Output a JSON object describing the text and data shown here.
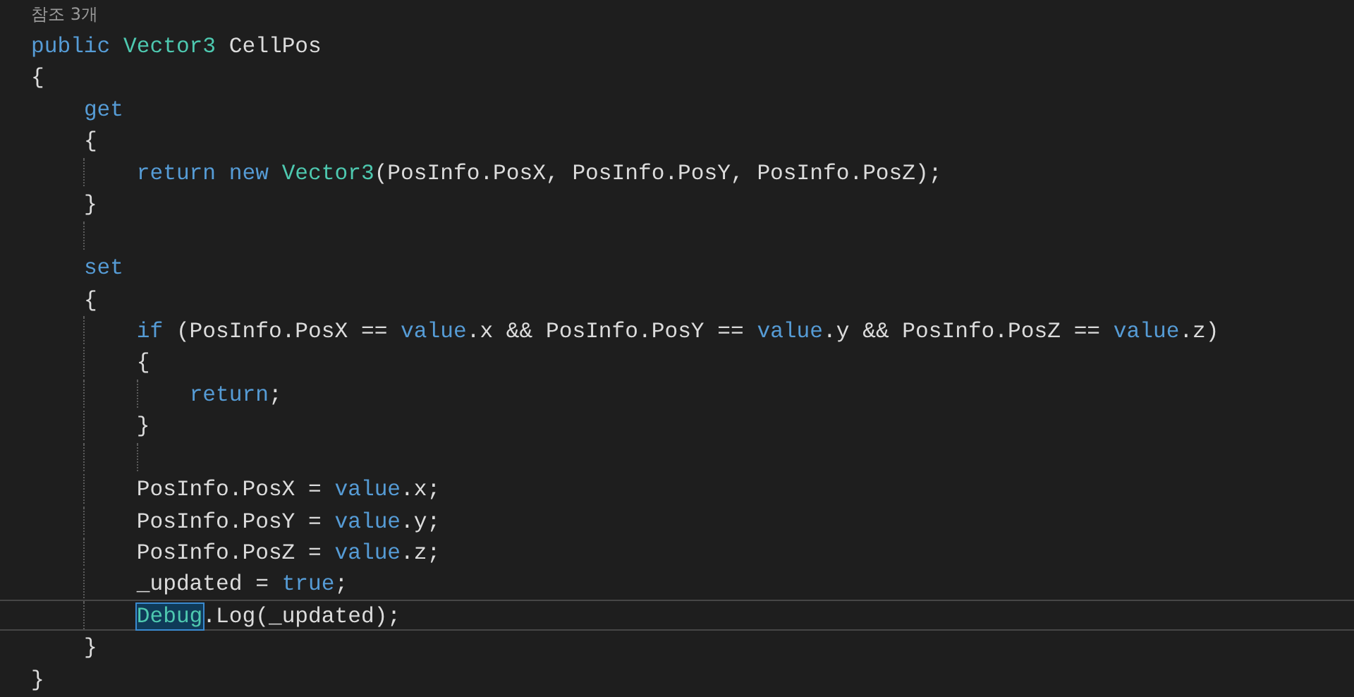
{
  "code_lens": "참조 3개",
  "lines": [
    {
      "current": false,
      "tokens": [
        {
          "text": "public ",
          "kind": "keyword"
        },
        {
          "text": "Vector3",
          "kind": "type"
        },
        {
          "text": " CellPos",
          "kind": "plain"
        }
      ]
    },
    {
      "current": false,
      "tokens": [
        {
          "text": "{",
          "kind": "plain"
        }
      ]
    },
    {
      "current": false,
      "tokens": [
        {
          "text": "get",
          "kind": "keyword"
        }
      ]
    },
    {
      "current": false,
      "tokens": [
        {
          "text": "{",
          "kind": "plain"
        }
      ]
    },
    {
      "current": false,
      "tokens": [
        {
          "text": "return new ",
          "kind": "keyword"
        },
        {
          "text": "Vector3",
          "kind": "type"
        },
        {
          "text": "(PosInfo.PosX, PosInfo.PosY, PosInfo.PosZ);",
          "kind": "plain"
        }
      ]
    },
    {
      "current": false,
      "tokens": [
        {
          "text": "}",
          "kind": "plain"
        }
      ]
    },
    {
      "current": false
    },
    {
      "current": false,
      "tokens": [
        {
          "text": "set",
          "kind": "keyword"
        }
      ]
    },
    {
      "current": false,
      "tokens": [
        {
          "text": "{",
          "kind": "plain"
        }
      ]
    },
    {
      "current": false,
      "tokens": [
        {
          "text": "if",
          "kind": "keyword"
        },
        {
          "text": " (PosInfo.PosX == ",
          "kind": "plain"
        },
        {
          "text": "value",
          "kind": "keyword"
        },
        {
          "text": ".x && PosInfo.PosY == ",
          "kind": "plain"
        },
        {
          "text": "value",
          "kind": "keyword"
        },
        {
          "text": ".y && PosInfo.PosZ == ",
          "kind": "plain"
        },
        {
          "text": "value",
          "kind": "keyword"
        },
        {
          "text": ".z)",
          "kind": "plain"
        }
      ]
    },
    {
      "current": false,
      "tokens": [
        {
          "text": "{",
          "kind": "plain"
        }
      ]
    },
    {
      "current": false,
      "tokens": [
        {
          "text": "return",
          "kind": "keyword"
        },
        {
          "text": ";",
          "kind": "plain"
        }
      ]
    },
    {
      "current": false,
      "tokens": [
        {
          "text": "}",
          "kind": "plain"
        }
      ]
    },
    {
      "current": false
    },
    {
      "current": false,
      "tokens": [
        {
          "text": "PosInfo.PosX = ",
          "kind": "plain"
        },
        {
          "text": "value",
          "kind": "keyword"
        },
        {
          "text": ".x;",
          "kind": "plain"
        }
      ]
    },
    {
      "current": false,
      "tokens": [
        {
          "text": "PosInfo.PosY = ",
          "kind": "plain"
        },
        {
          "text": "value",
          "kind": "keyword"
        },
        {
          "text": ".y;",
          "kind": "plain"
        }
      ]
    },
    {
      "current": false,
      "tokens": [
        {
          "text": "PosInfo.PosZ = ",
          "kind": "plain"
        },
        {
          "text": "value",
          "kind": "keyword"
        },
        {
          "text": ".z;",
          "kind": "plain"
        }
      ]
    },
    {
      "current": false,
      "tokens": [
        {
          "text": "_updated = ",
          "kind": "plain"
        },
        {
          "text": "true",
          "kind": "keyword"
        },
        {
          "text": ";",
          "kind": "plain"
        }
      ]
    },
    {
      "current": true,
      "tokens": [
        {
          "text": "Debug",
          "kind": "type",
          "highlighted": true
        },
        {
          "text": ".Log(_updated);",
          "kind": "plain",
          "highlighted": false
        }
      ]
    },
    {
      "current": false,
      "tokens": [
        {
          "text": "}",
          "kind": "plain"
        }
      ]
    },
    {
      "current": false,
      "tokens": [
        {
          "text": "}",
          "kind": "plain"
        }
      ]
    }
  ]
}
